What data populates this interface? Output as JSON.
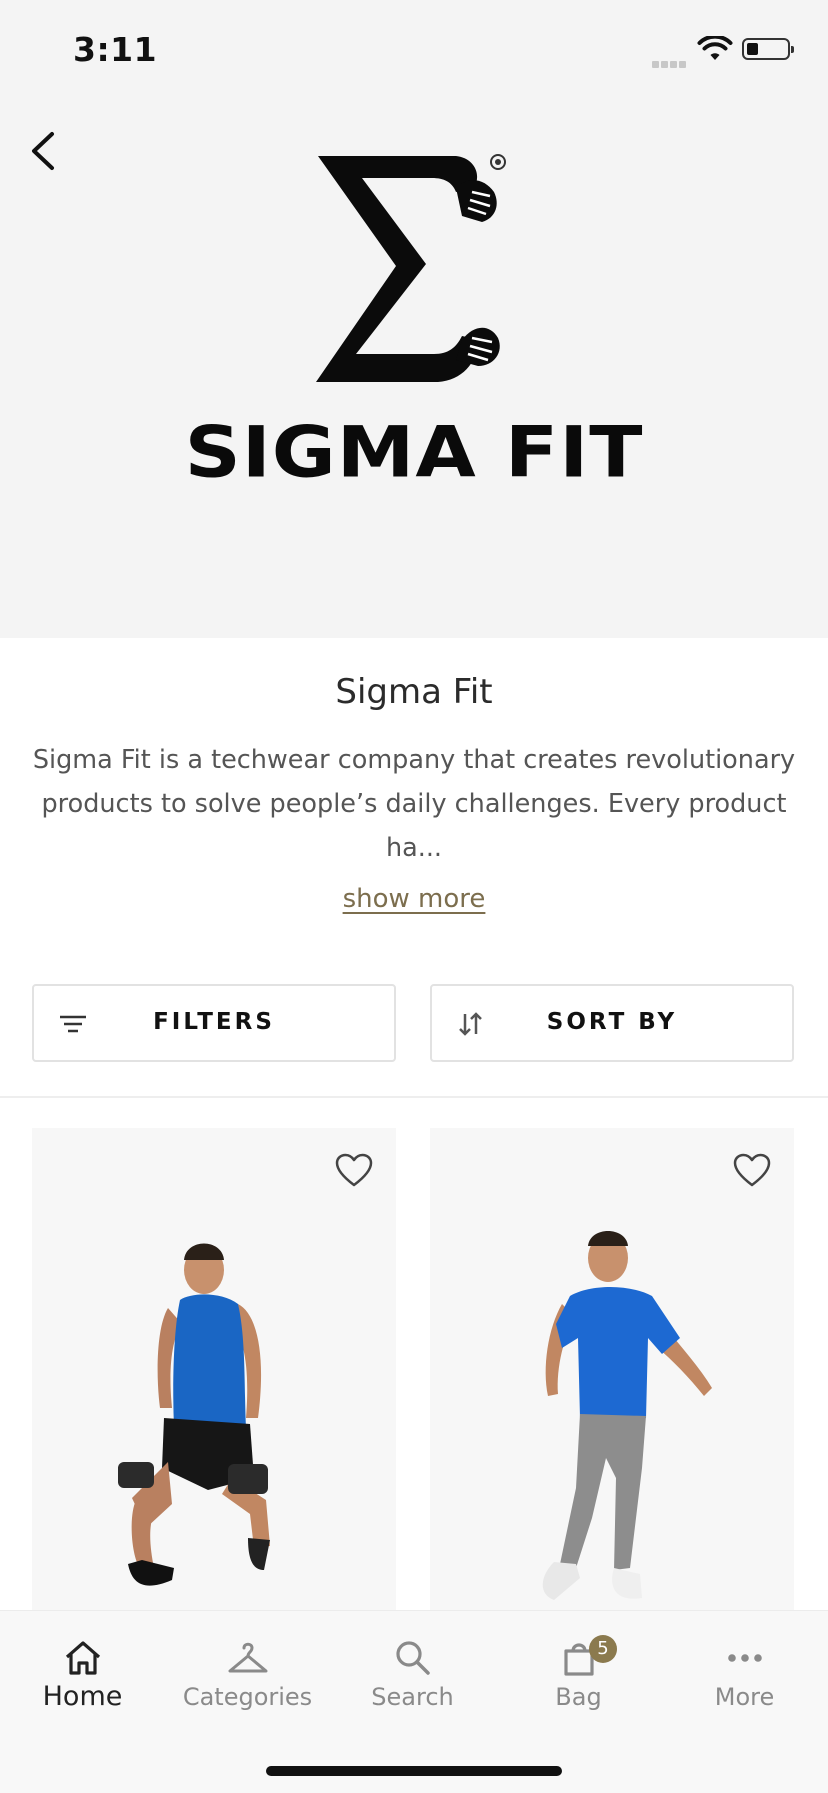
{
  "status_bar": {
    "time": "3:11",
    "battery_level": 0.3
  },
  "brand": {
    "logo_text": "SIGMA FIT",
    "name": "Sigma Fit",
    "description": "Sigma Fit is a techwear company that creates revolutionary products to solve people’s daily challenges. Every product ha...",
    "show_more_label": "show more"
  },
  "toolbar": {
    "filters_label": "FILTERS",
    "sort_label": "SORT BY"
  },
  "products": [
    {
      "icon": "heart-outline-icon"
    },
    {
      "icon": "heart-outline-icon"
    }
  ],
  "tab_bar": {
    "tabs": [
      {
        "label": "Home",
        "icon": "home-icon",
        "active": true
      },
      {
        "label": "Categories",
        "icon": "hanger-icon",
        "active": false
      },
      {
        "label": "Search",
        "icon": "search-icon",
        "active": false
      },
      {
        "label": "Bag",
        "icon": "bag-icon",
        "active": false,
        "badge": "5"
      },
      {
        "label": "More",
        "icon": "more-icon",
        "active": false
      }
    ]
  },
  "colors": {
    "accent": "#7c6e4e",
    "badge": "#8b7a4e",
    "hero_bg": "#f4f4f4"
  }
}
